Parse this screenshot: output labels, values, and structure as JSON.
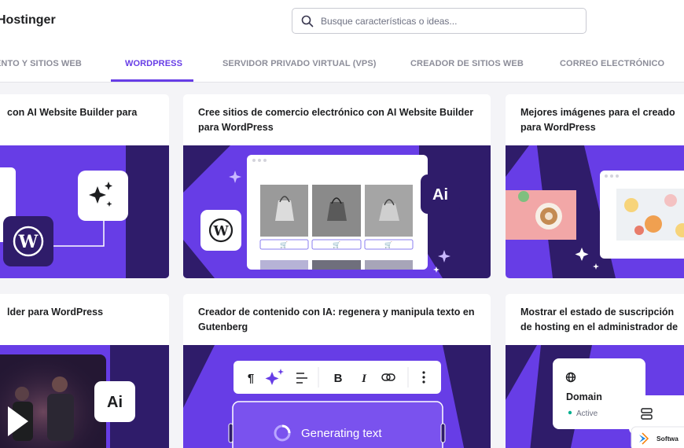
{
  "header": {
    "brand": "Hostinger",
    "search_placeholder": "Busque características o ideas..."
  },
  "tabs": [
    {
      "label": "ENTO Y SITIOS WEB",
      "active": false
    },
    {
      "label": "WORDPRESS",
      "active": true
    },
    {
      "label": "SERVIDOR PRIVADO VIRTUAL (VPS)",
      "active": false
    },
    {
      "label": "CREADOR DE SITIOS WEB",
      "active": false
    },
    {
      "label": "CORREO ELECTRÓNICO",
      "active": false
    }
  ],
  "cards": [
    {
      "title": "con AI Website Builder para"
    },
    {
      "title": "Cree sitios de comercio electrónico con AI Website Builder para WordPress"
    },
    {
      "title": "Mejores imágenes para el creado para WordPress"
    },
    {
      "title": "lder para WordPress"
    },
    {
      "title": "Creador de contenido con IA: regenera y manipula texto en Gutenberg"
    },
    {
      "title": "Mostrar el estado de suscripción de hosting en el administrador de"
    }
  ],
  "art": {
    "ai_badge": "Ai",
    "toolbar_bold": "B",
    "toolbar_italic": "I",
    "generating_text": "Generating text",
    "domain_label": "Domain",
    "domain_status": "Active",
    "software_label": "Softwa"
  },
  "colors": {
    "accent": "#673de6",
    "dark_navy": "#2f1c6a",
    "tab_inactive": "#8c8d99"
  }
}
